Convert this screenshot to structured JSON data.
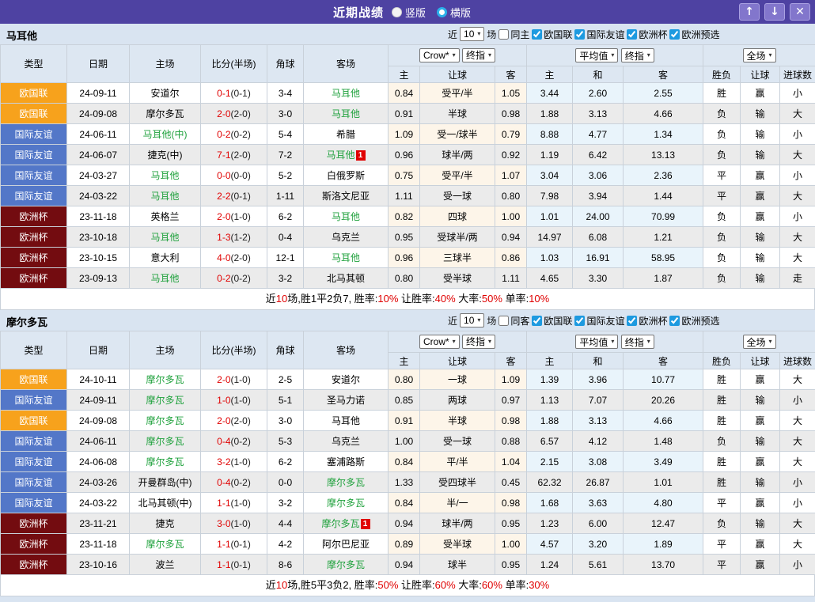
{
  "titlebar": {
    "title": "近期战绩",
    "radios": [
      {
        "label": "竖版",
        "checked": false
      },
      {
        "label": "横版",
        "checked": true
      }
    ],
    "up_button": "↑",
    "down_button": "↓",
    "close_button": "✕"
  },
  "table_header": {
    "type": "类型",
    "date": "日期",
    "home": "主场",
    "score": "比分(半场)",
    "corner": "角球",
    "away": "客场",
    "crow_select": "Crow*",
    "final_select": "终指",
    "avg_select": "平均值",
    "final_select2": "终指",
    "full_select": "全场",
    "h1": "主",
    "handicap1": "让球",
    "a1": "客",
    "h2": "主",
    "draw": "和",
    "a2": "客",
    "result": "胜负",
    "handicap2": "让球",
    "goals": "进球数"
  },
  "colors": {
    "titlebar_bg": "#4e42a2",
    "titlebar_button_bg": "#8276cc",
    "section_bg": "#d9e4f1",
    "header_bg": "#dde7f2",
    "type_league_nations": "#f7a21c",
    "type_friendly": "#5377c8",
    "type_eurocup": "#730c10",
    "win_red": "#e00000",
    "lose_blue": "#3333cc",
    "draw_green": "#1fa13c",
    "team_green": "#1fa13c",
    "crow_col_bg": "#fdf5e9",
    "avg_col_bg": "#e9f4fb",
    "even_row_bg": "#ebebeb",
    "checkbox_blue": "#1d9ae0"
  },
  "sections": [
    {
      "team": "马耳他",
      "filter": {
        "near_label": "近",
        "count": "10",
        "games_label": "场",
        "same_label": "同主",
        "same_checked": false,
        "leagues": [
          {
            "label": "欧国联",
            "checked": true
          },
          {
            "label": "国际友谊",
            "checked": true
          },
          {
            "label": "欧洲杯",
            "checked": true
          },
          {
            "label": "欧洲预选",
            "checked": true
          }
        ]
      },
      "rows": [
        {
          "type": "欧国联",
          "tc": "o",
          "date": "24-09-11",
          "home": "安道尔",
          "hg": false,
          "score": "0-1",
          "half": "(0-1)",
          "corner": "3-4",
          "away": "马耳他",
          "ag": true,
          "crow": [
            "0.84",
            "受平/半",
            "1.05"
          ],
          "avg": [
            "3.44",
            "2.60",
            "2.55"
          ],
          "res": [
            "胜",
            "r"
          ],
          "lt": [
            "赢",
            "r"
          ],
          "goal": [
            "小",
            "b"
          ]
        },
        {
          "type": "欧国联",
          "tc": "o",
          "date": "24-09-08",
          "home": "摩尔多瓦",
          "hg": false,
          "score": "2-0",
          "half": "(2-0)",
          "corner": "3-0",
          "away": "马耳他",
          "ag": true,
          "crow": [
            "0.91",
            "半球",
            "0.98"
          ],
          "avg": [
            "1.88",
            "3.13",
            "4.66"
          ],
          "res": [
            "负",
            "b"
          ],
          "lt": [
            "输",
            "b"
          ],
          "goal": [
            "大",
            "r"
          ]
        },
        {
          "type": "国际友谊",
          "tc": "b",
          "date": "24-06-11",
          "home": "马耳他(中)",
          "hg": true,
          "score": "0-2",
          "half": "(0-2)",
          "corner": "5-4",
          "away": "希腊",
          "ag": false,
          "crow": [
            "1.09",
            "受一/球半",
            "0.79"
          ],
          "avg": [
            "8.88",
            "4.77",
            "1.34"
          ],
          "res": [
            "负",
            "b"
          ],
          "lt": [
            "输",
            "b"
          ],
          "goal": [
            "小",
            "b"
          ]
        },
        {
          "type": "国际友谊",
          "tc": "b",
          "date": "24-06-07",
          "home": "捷克(中)",
          "hg": false,
          "score": "7-1",
          "half": "(2-0)",
          "corner": "7-2",
          "away": "马耳他",
          "ag": true,
          "ab": "1",
          "crow": [
            "0.96",
            "球半/两",
            "0.92"
          ],
          "avg": [
            "1.19",
            "6.42",
            "13.13"
          ],
          "res": [
            "负",
            "b"
          ],
          "lt": [
            "输",
            "b"
          ],
          "goal": [
            "大",
            "r"
          ]
        },
        {
          "type": "国际友谊",
          "tc": "b",
          "date": "24-03-27",
          "home": "马耳他",
          "hg": true,
          "score": "0-0",
          "half": "(0-0)",
          "corner": "5-2",
          "away": "白俄罗斯",
          "ag": false,
          "crow": [
            "0.75",
            "受平/半",
            "1.07"
          ],
          "avg": [
            "3.04",
            "3.06",
            "2.36"
          ],
          "res": [
            "平",
            "g"
          ],
          "lt": [
            "赢",
            "r"
          ],
          "goal": [
            "小",
            "b"
          ]
        },
        {
          "type": "国际友谊",
          "tc": "b",
          "date": "24-03-22",
          "home": "马耳他",
          "hg": true,
          "score": "2-2",
          "half": "(0-1)",
          "corner": "1-11",
          "away": "斯洛文尼亚",
          "ag": false,
          "crow": [
            "1.11",
            "受一球",
            "0.80"
          ],
          "avg": [
            "7.98",
            "3.94",
            "1.44"
          ],
          "res": [
            "平",
            "g"
          ],
          "lt": [
            "赢",
            "r"
          ],
          "goal": [
            "大",
            "r"
          ]
        },
        {
          "type": "欧洲杯",
          "tc": "m",
          "date": "23-11-18",
          "home": "英格兰",
          "hg": false,
          "score": "2-0",
          "half": "(1-0)",
          "corner": "6-2",
          "away": "马耳他",
          "ag": true,
          "crow": [
            "0.82",
            "四球",
            "1.00"
          ],
          "avg": [
            "1.01",
            "24.00",
            "70.99"
          ],
          "res": [
            "负",
            "b"
          ],
          "lt": [
            "赢",
            "r"
          ],
          "goal": [
            "小",
            "b"
          ]
        },
        {
          "type": "欧洲杯",
          "tc": "m",
          "date": "23-10-18",
          "home": "马耳他",
          "hg": true,
          "score": "1-3",
          "half": "(1-2)",
          "corner": "0-4",
          "away": "乌克兰",
          "ag": false,
          "crow": [
            "0.95",
            "受球半/两",
            "0.94"
          ],
          "avg": [
            "14.97",
            "6.08",
            "1.21"
          ],
          "res": [
            "负",
            "b"
          ],
          "lt": [
            "输",
            "b"
          ],
          "goal": [
            "大",
            "r"
          ]
        },
        {
          "type": "欧洲杯",
          "tc": "m",
          "date": "23-10-15",
          "home": "意大利",
          "hg": false,
          "score": "4-0",
          "half": "(2-0)",
          "corner": "12-1",
          "away": "马耳他",
          "ag": true,
          "crow": [
            "0.96",
            "三球半",
            "0.86"
          ],
          "avg": [
            "1.03",
            "16.91",
            "58.95"
          ],
          "res": [
            "负",
            "b"
          ],
          "lt": [
            "输",
            "b"
          ],
          "goal": [
            "大",
            "r"
          ]
        },
        {
          "type": "欧洲杯",
          "tc": "m",
          "date": "23-09-13",
          "home": "马耳他",
          "hg": true,
          "score": "0-2",
          "half": "(0-2)",
          "corner": "3-2",
          "away": "北马其顿",
          "ag": false,
          "crow": [
            "0.80",
            "受半球",
            "1.11"
          ],
          "avg": [
            "4.65",
            "3.30",
            "1.87"
          ],
          "res": [
            "负",
            "b"
          ],
          "lt": [
            "输",
            "b"
          ],
          "goal": [
            "走",
            "g"
          ]
        }
      ],
      "summary": [
        {
          "t": "近",
          "r": false
        },
        {
          "t": "10",
          "r": true
        },
        {
          "t": "场,胜1平2负7, 胜率:",
          "r": false
        },
        {
          "t": "10%",
          "r": true
        },
        {
          "t": " 让胜率:",
          "r": false
        },
        {
          "t": "40%",
          "r": true
        },
        {
          "t": " 大率:",
          "r": false
        },
        {
          "t": "50%",
          "r": true
        },
        {
          "t": " 单率:",
          "r": false
        },
        {
          "t": "10%",
          "r": true
        }
      ]
    },
    {
      "team": "摩尔多瓦",
      "filter": {
        "near_label": "近",
        "count": "10",
        "games_label": "场",
        "same_label": "同客",
        "same_checked": false,
        "leagues": [
          {
            "label": "欧国联",
            "checked": true
          },
          {
            "label": "国际友谊",
            "checked": true
          },
          {
            "label": "欧洲杯",
            "checked": true
          },
          {
            "label": "欧洲预选",
            "checked": true
          }
        ]
      },
      "rows": [
        {
          "type": "欧国联",
          "tc": "o",
          "date": "24-10-11",
          "home": "摩尔多瓦",
          "hg": true,
          "score": "2-0",
          "half": "(1-0)",
          "corner": "2-5",
          "away": "安道尔",
          "ag": false,
          "crow": [
            "0.80",
            "一球",
            "1.09"
          ],
          "avg": [
            "1.39",
            "3.96",
            "10.77"
          ],
          "res": [
            "胜",
            "r"
          ],
          "lt": [
            "赢",
            "r"
          ],
          "goal": [
            "大",
            "r"
          ]
        },
        {
          "type": "国际友谊",
          "tc": "b",
          "date": "24-09-11",
          "home": "摩尔多瓦",
          "hg": true,
          "score": "1-0",
          "half": "(1-0)",
          "corner": "5-1",
          "away": "圣马力诺",
          "ag": false,
          "crow": [
            "0.85",
            "两球",
            "0.97"
          ],
          "avg": [
            "1.13",
            "7.07",
            "20.26"
          ],
          "res": [
            "胜",
            "r"
          ],
          "lt": [
            "输",
            "b"
          ],
          "goal": [
            "小",
            "b"
          ]
        },
        {
          "type": "欧国联",
          "tc": "o",
          "date": "24-09-08",
          "home": "摩尔多瓦",
          "hg": true,
          "score": "2-0",
          "half": "(2-0)",
          "corner": "3-0",
          "away": "马耳他",
          "ag": false,
          "crow": [
            "0.91",
            "半球",
            "0.98"
          ],
          "avg": [
            "1.88",
            "3.13",
            "4.66"
          ],
          "res": [
            "胜",
            "r"
          ],
          "lt": [
            "赢",
            "r"
          ],
          "goal": [
            "大",
            "r"
          ]
        },
        {
          "type": "国际友谊",
          "tc": "b",
          "date": "24-06-11",
          "home": "摩尔多瓦",
          "hg": true,
          "score": "0-4",
          "half": "(0-2)",
          "corner": "5-3",
          "away": "乌克兰",
          "ag": false,
          "crow": [
            "1.00",
            "受一球",
            "0.88"
          ],
          "avg": [
            "6.57",
            "4.12",
            "1.48"
          ],
          "res": [
            "负",
            "b"
          ],
          "lt": [
            "输",
            "b"
          ],
          "goal": [
            "大",
            "r"
          ]
        },
        {
          "type": "国际友谊",
          "tc": "b",
          "date": "24-06-08",
          "home": "摩尔多瓦",
          "hg": true,
          "score": "3-2",
          "half": "(1-0)",
          "corner": "6-2",
          "away": "塞浦路斯",
          "ag": false,
          "crow": [
            "0.84",
            "平/半",
            "1.04"
          ],
          "avg": [
            "2.15",
            "3.08",
            "3.49"
          ],
          "res": [
            "胜",
            "r"
          ],
          "lt": [
            "赢",
            "r"
          ],
          "goal": [
            "大",
            "r"
          ]
        },
        {
          "type": "国际友谊",
          "tc": "b",
          "date": "24-03-26",
          "home": "开曼群岛(中)",
          "hg": false,
          "score": "0-4",
          "half": "(0-2)",
          "corner": "0-0",
          "away": "摩尔多瓦",
          "ag": true,
          "crow": [
            "1.33",
            "受四球半",
            "0.45"
          ],
          "avg": [
            "62.32",
            "26.87",
            "1.01"
          ],
          "res": [
            "胜",
            "r"
          ],
          "lt": [
            "输",
            "b"
          ],
          "goal": [
            "小",
            "b"
          ]
        },
        {
          "type": "国际友谊",
          "tc": "b",
          "date": "24-03-22",
          "home": "北马其顿(中)",
          "hg": false,
          "score": "1-1",
          "half": "(1-0)",
          "corner": "3-2",
          "away": "摩尔多瓦",
          "ag": true,
          "crow": [
            "0.84",
            "半/一",
            "0.98"
          ],
          "avg": [
            "1.68",
            "3.63",
            "4.80"
          ],
          "res": [
            "平",
            "g"
          ],
          "lt": [
            "赢",
            "r"
          ],
          "goal": [
            "小",
            "b"
          ]
        },
        {
          "type": "欧洲杯",
          "tc": "m",
          "date": "23-11-21",
          "home": "捷克",
          "hg": false,
          "score": "3-0",
          "half": "(1-0)",
          "corner": "4-4",
          "away": "摩尔多瓦",
          "ag": true,
          "ab": "1",
          "crow": [
            "0.94",
            "球半/两",
            "0.95"
          ],
          "avg": [
            "1.23",
            "6.00",
            "12.47"
          ],
          "res": [
            "负",
            "b"
          ],
          "lt": [
            "输",
            "b"
          ],
          "goal": [
            "大",
            "r"
          ]
        },
        {
          "type": "欧洲杯",
          "tc": "m",
          "date": "23-11-18",
          "home": "摩尔多瓦",
          "hg": true,
          "score": "1-1",
          "half": "(0-1)",
          "corner": "4-2",
          "away": "阿尔巴尼亚",
          "ag": false,
          "crow": [
            "0.89",
            "受半球",
            "1.00"
          ],
          "avg": [
            "4.57",
            "3.20",
            "1.89"
          ],
          "res": [
            "平",
            "g"
          ],
          "lt": [
            "赢",
            "r"
          ],
          "goal": [
            "大",
            "r"
          ]
        },
        {
          "type": "欧洲杯",
          "tc": "m",
          "date": "23-10-16",
          "home": "波兰",
          "hg": false,
          "score": "1-1",
          "half": "(0-1)",
          "corner": "8-6",
          "away": "摩尔多瓦",
          "ag": true,
          "crow": [
            "0.94",
            "球半",
            "0.95"
          ],
          "avg": [
            "1.24",
            "5.61",
            "13.70"
          ],
          "res": [
            "平",
            "g"
          ],
          "lt": [
            "赢",
            "r"
          ],
          "goal": [
            "小",
            "b"
          ]
        }
      ],
      "summary": [
        {
          "t": "近",
          "r": false
        },
        {
          "t": "10",
          "r": true
        },
        {
          "t": "场,胜5平3负2, 胜率:",
          "r": false
        },
        {
          "t": "50%",
          "r": true
        },
        {
          "t": " 让胜率:",
          "r": false
        },
        {
          "t": "60%",
          "r": true
        },
        {
          "t": " 大率:",
          "r": false
        },
        {
          "t": "60%",
          "r": true
        },
        {
          "t": " 单率:",
          "r": false
        },
        {
          "t": "30%",
          "r": true
        }
      ]
    }
  ]
}
